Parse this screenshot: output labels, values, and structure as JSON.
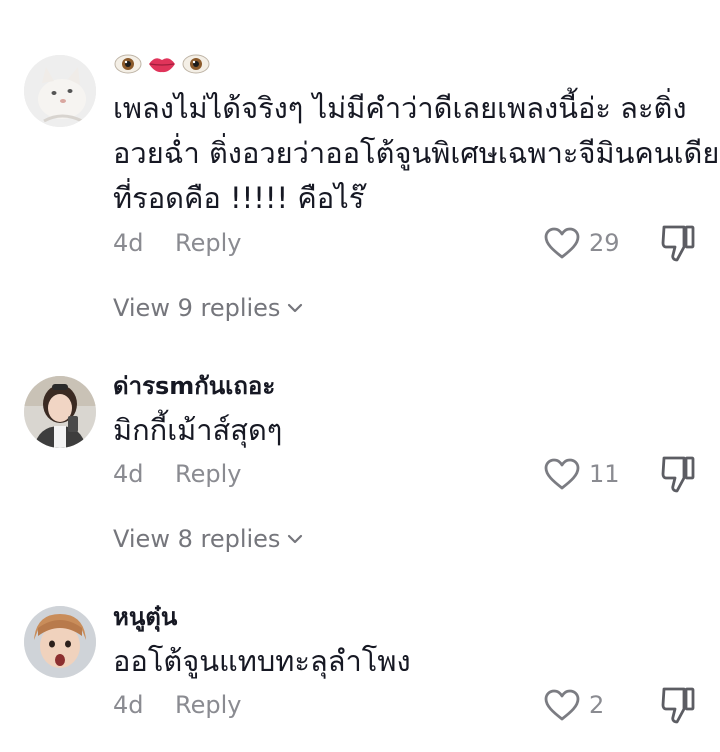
{
  "comments": [
    {
      "username": "",
      "username_emoji": [
        "eye",
        "lips",
        "eye"
      ],
      "lines": [
        "เพลงไม่ได้จริงๆ ไม่มีคำว่าดีเลยเพลงนี้อ่ะ ละติ่ง",
        "อวยฉ่ำ ติ่งอวยว่าออโต้จูนพิเศษเฉพาะจีมินคนเดียว",
        "ที่รอดคือ !!!!! คือไร๊"
      ],
      "time": "4d",
      "reply_label": "Reply",
      "likes": "29",
      "view_replies": "View 9 replies"
    },
    {
      "username": "ด่ารsmกันเถอะ",
      "lines": [
        "มิกกี้เม้าส์สุดๆ"
      ],
      "time": "4d",
      "reply_label": "Reply",
      "likes": "11",
      "view_replies": "View 8 replies"
    },
    {
      "username": "หนูตุ๋น",
      "lines": [
        "ออโต้จูนแทบทะลุลำโพง"
      ],
      "time": "4d",
      "reply_label": "Reply",
      "likes": "2"
    }
  ],
  "icons": {
    "like": "heart-outline-icon",
    "dislike": "thumbs-down-icon",
    "view_replies": "chevron-down-icon"
  },
  "colors": {
    "text": "#161823",
    "secondary": "#8a8b91",
    "view_replies": "#75767c",
    "lips": "#e0345a"
  }
}
